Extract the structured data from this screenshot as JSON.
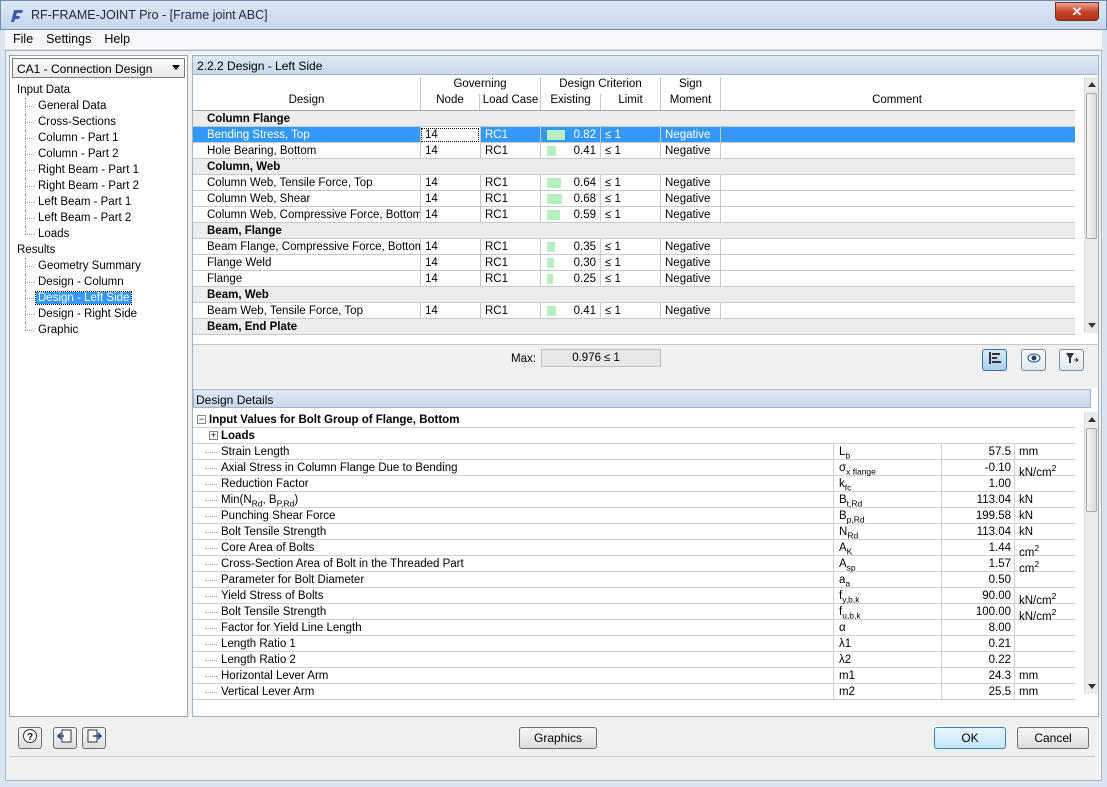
{
  "window": {
    "title": "RF-FRAME-JOINT Pro - [Frame joint ABC]",
    "close": "✕"
  },
  "menu": [
    "File",
    "Settings",
    "Help"
  ],
  "nav": {
    "case": "CA1 - Connection Design",
    "input_root": "Input Data",
    "input_items": [
      "General Data",
      "Cross-Sections",
      "Column - Part 1",
      "Column - Part 2",
      "Right Beam - Part 1",
      "Right Beam - Part 2",
      "Left Beam - Part 1",
      "Left Beam - Part 2",
      "Loads"
    ],
    "results_root": "Results",
    "results_items": [
      "Geometry Summary",
      "Design - Column",
      "Design - Left Side",
      "Design - Right Side",
      "Graphic"
    ],
    "selected": "Design - Left Side"
  },
  "section": {
    "title": "2.2.2 Design - Left Side"
  },
  "table": {
    "headers": {
      "design": "Design",
      "governing": "Governing",
      "node": "Node",
      "load_case": "Load Case",
      "criterion": "Design Criterion",
      "existing": "Existing",
      "limit": "Limit",
      "sign": "Sign",
      "moment": "Moment",
      "comment": "Comment"
    },
    "rows": [
      {
        "type": "group",
        "label": "Column Flange"
      },
      {
        "type": "row",
        "design": "Bending Stress, Top",
        "node": "14",
        "lc": "RC1",
        "existing": "0.82",
        "ratio": 0.82,
        "limit": "≤ 1",
        "sign": "Negative",
        "selected": true
      },
      {
        "type": "row",
        "design": "Hole Bearing, Bottom",
        "node": "14",
        "lc": "RC1",
        "existing": "0.41",
        "ratio": 0.41,
        "limit": "≤ 1",
        "sign": "Negative"
      },
      {
        "type": "group",
        "label": "Column, Web"
      },
      {
        "type": "row",
        "design": "Column Web, Tensile Force, Top",
        "node": "14",
        "lc": "RC1",
        "existing": "0.64",
        "ratio": 0.64,
        "limit": "≤ 1",
        "sign": "Negative"
      },
      {
        "type": "row",
        "design": "Column Web, Shear",
        "node": "14",
        "lc": "RC1",
        "existing": "0.68",
        "ratio": 0.68,
        "limit": "≤ 1",
        "sign": "Negative"
      },
      {
        "type": "row",
        "design": "Column Web, Compressive Force, Bottom",
        "node": "14",
        "lc": "RC1",
        "existing": "0.59",
        "ratio": 0.59,
        "limit": "≤ 1",
        "sign": "Negative"
      },
      {
        "type": "group",
        "label": "Beam, Flange"
      },
      {
        "type": "row",
        "design": "Beam Flange, Compressive Force, Bottom",
        "node": "14",
        "lc": "RC1",
        "existing": "0.35",
        "ratio": 0.35,
        "limit": "≤ 1",
        "sign": "Negative"
      },
      {
        "type": "row",
        "design": "Flange Weld",
        "node": "14",
        "lc": "RC1",
        "existing": "0.30",
        "ratio": 0.3,
        "limit": "≤ 1",
        "sign": "Negative"
      },
      {
        "type": "row",
        "design": "Flange",
        "node": "14",
        "lc": "RC1",
        "existing": "0.25",
        "ratio": 0.25,
        "limit": "≤ 1",
        "sign": "Negative"
      },
      {
        "type": "group",
        "label": "Beam, Web"
      },
      {
        "type": "row",
        "design": "Beam Web, Tensile Force, Top",
        "node": "14",
        "lc": "RC1",
        "existing": "0.41",
        "ratio": 0.41,
        "limit": "≤ 1",
        "sign": "Negative"
      },
      {
        "type": "group",
        "label": "Beam, End Plate"
      }
    ],
    "max_label": "Max:",
    "max_value": "0.976",
    "max_limit": "≤ 1"
  },
  "details": {
    "title": "Design Details",
    "group": "Input Values for Bolt Group of Flange, Bottom",
    "subgroup": "Loads",
    "rows": [
      {
        "name": "Strain Length",
        "sym": "L",
        "sub": "b",
        "value": "57.5",
        "unit": "mm"
      },
      {
        "name": "Axial Stress in Column Flange Due to Bending",
        "sym": "σ",
        "sub": "x flange",
        "value": "-0.10",
        "unit": "kN/cm",
        "sup": "2"
      },
      {
        "name": "Reduction Factor",
        "sym": "k",
        "sub": "fc",
        "value": "1.00",
        "unit": ""
      },
      {
        "name": "Min(N",
        "name_sub": "Rd",
        "name2": ", B",
        "name2_sub": "P,Rd",
        "name3": ")",
        "sym": "B",
        "sub": "t,Rd",
        "value": "113.04",
        "unit": "kN"
      },
      {
        "name": "Punching Shear Force",
        "sym": "B",
        "sub": "p,Rd",
        "value": "199.58",
        "unit": "kN"
      },
      {
        "name": "Bolt Tensile Strength",
        "sym": "N",
        "sub": "Rd",
        "value": "113.04",
        "unit": "kN"
      },
      {
        "name": "Core Area of Bolts",
        "sym": "A",
        "sub": "K",
        "value": "1.44",
        "unit": "cm",
        "sup": "2"
      },
      {
        "name": "Cross-Section Area of Bolt in the Threaded Part",
        "sym": "A",
        "sub": "sp",
        "value": "1.57",
        "unit": "cm",
        "sup": "2"
      },
      {
        "name": "Parameter for Bolt Diameter",
        "sym": "a",
        "sub": "a",
        "value": "0.50",
        "unit": ""
      },
      {
        "name": "Yield Stress of Bolts",
        "sym": "f",
        "sub": "y,b,k",
        "value": "90.00",
        "unit": "kN/cm",
        "sup": "2"
      },
      {
        "name": "Bolt Tensile Strength",
        "sym": "f",
        "sub": "u,b,k",
        "value": "100.00",
        "unit": "kN/cm",
        "sup": "2"
      },
      {
        "name": "Factor for Yield Line Length",
        "sym": "α",
        "sub": "",
        "value": "8.00",
        "unit": ""
      },
      {
        "name": "Length Ratio 1",
        "sym": "λ1",
        "sub": "",
        "value": "0.21",
        "unit": ""
      },
      {
        "name": "Length Ratio 2",
        "sym": "λ2",
        "sub": "",
        "value": "0.22",
        "unit": ""
      },
      {
        "name": "Horizontal Lever Arm",
        "sym": "m1",
        "sub": "",
        "value": "24.3",
        "unit": "mm"
      },
      {
        "name": "Vertical Lever Arm",
        "sym": "m2",
        "sub": "",
        "value": "25.5",
        "unit": "mm"
      }
    ]
  },
  "buttons": {
    "graphics": "Graphics",
    "ok": "OK",
    "cancel": "Cancel"
  },
  "icons": {
    "help": "help-icon",
    "import": "import-icon",
    "export": "export-icon"
  }
}
